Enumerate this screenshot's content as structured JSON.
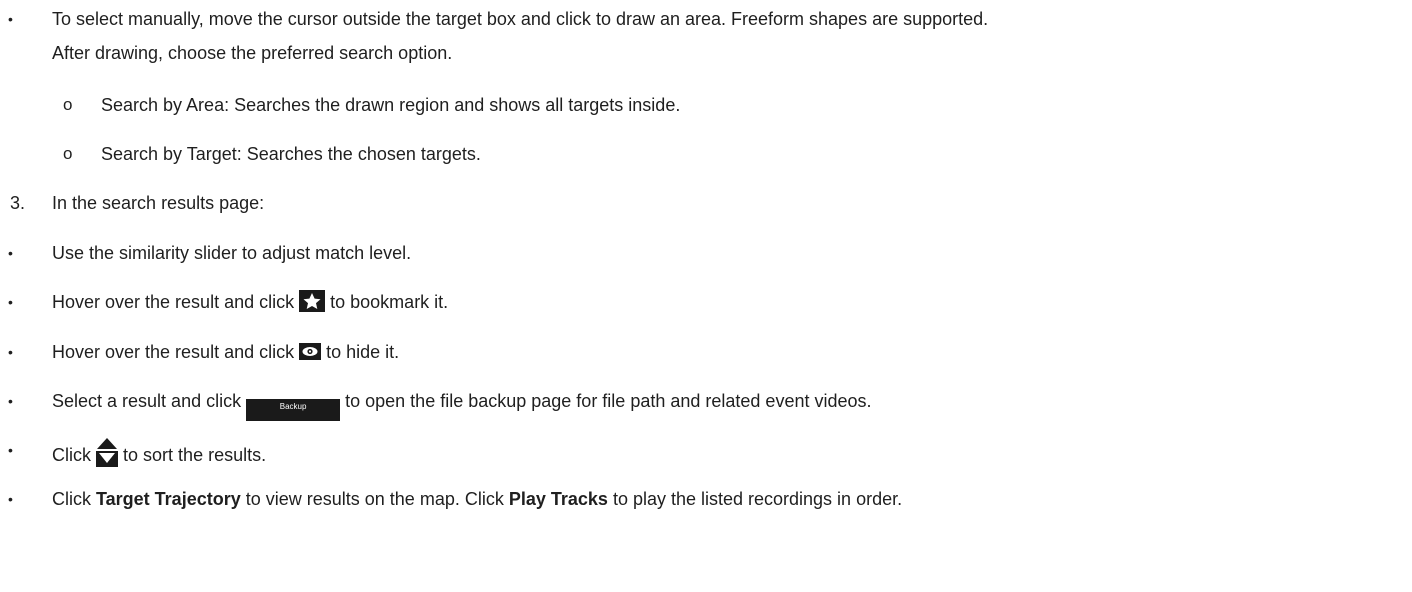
{
  "items": {
    "manual_select": {
      "line1": "To select manually, move the cursor outside the target box and click to draw an area. Freeform shapes are supported.",
      "line2": "After drawing, choose the preferred search option."
    },
    "sub_options": [
      "Search by Area: Searches the drawn region and shows all targets inside.",
      "Search by Target: Searches the chosen targets."
    ],
    "step3": {
      "number": "3.",
      "text": "In the search results page:"
    },
    "similarity": "Use the similarity slider to adjust match level.",
    "bookmark": {
      "before": "Hover over the result and click",
      "after": "to bookmark it."
    },
    "hide": {
      "before": "Hover over the result and click",
      "after": "to hide it."
    },
    "backup": {
      "before": "Select a result and click",
      "button_label": "Backup",
      "after": "to open the file backup page for file path and related event videos."
    },
    "sort": {
      "before": "Click",
      "after": "to sort the results."
    },
    "trajectory": {
      "part1": "Click ",
      "bold1": "Target Trajectory",
      "part2": " to view results on the map. Click ",
      "bold2": "Play Tracks",
      "part3": " to play the listed recordings in order."
    }
  },
  "bullet_char": "•",
  "sub_bullet_char": "o",
  "icons": [
    "star-icon",
    "eye-icon",
    "sort-icon"
  ]
}
